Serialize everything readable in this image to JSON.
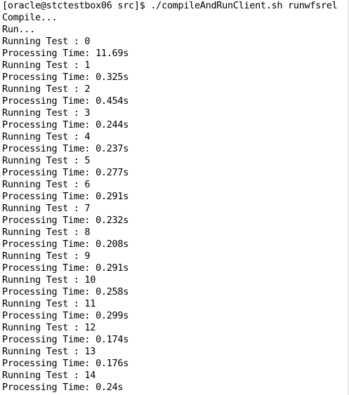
{
  "terminal": {
    "lines": [
      "[oracle@stctestbox06 src]$ ./compileAndRunClient.sh runwfsrel",
      "Compile...",
      "Run...",
      "Running Test : 0",
      "Processing Time: 11.69s",
      "Running Test : 1",
      "Processing Time: 0.325s",
      "Running Test : 2",
      "Processing Time: 0.454s",
      "Running Test : 3",
      "Processing Time: 0.244s",
      "Running Test : 4",
      "Processing Time: 0.237s",
      "Running Test : 5",
      "Processing Time: 0.277s",
      "Running Test : 6",
      "Processing Time: 0.291s",
      "Running Test : 7",
      "Processing Time: 0.232s",
      "Running Test : 8",
      "Processing Time: 0.208s",
      "Running Test : 9",
      "Processing Time: 0.291s",
      "Running Test : 10",
      "Processing Time: 0.258s",
      "Running Test : 11",
      "Processing Time: 0.299s",
      "Running Test : 12",
      "Processing Time: 0.174s",
      "Running Test : 13",
      "Processing Time: 0.176s",
      "Running Test : 14",
      "Processing Time: 0.24s"
    ]
  }
}
